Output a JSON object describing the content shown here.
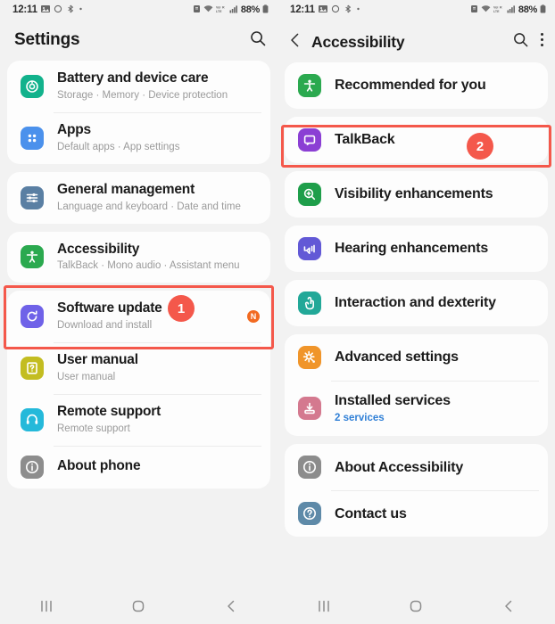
{
  "statusbar": {
    "time": "12:11",
    "battery": "88%",
    "left_icons": [
      "screenshot-icon",
      "circle-icon",
      "bluetooth-share-icon",
      "dot-icon"
    ],
    "right_icons": [
      "alarm-icon",
      "wifi-icon",
      "volte-icon",
      "signal-icon",
      "battery-icon"
    ]
  },
  "left_phone": {
    "appbar": {
      "title": "Settings",
      "search_icon": "search-icon"
    },
    "groups": [
      {
        "rows": [
          {
            "title": "Battery and device care",
            "sub": "Storage · Memory · Device protection",
            "icon": "battery-care-icon",
            "color": "#12b28c"
          },
          {
            "title": "Apps",
            "sub": "Default apps · App settings",
            "icon": "apps-icon",
            "color": "#4b91ec"
          }
        ]
      },
      {
        "rows": [
          {
            "title": "General management",
            "sub": "Language and keyboard · Date and time",
            "icon": "sliders-icon",
            "color": "#5a7fa3"
          }
        ]
      },
      {
        "rows": [
          {
            "title": "Accessibility",
            "sub": "TalkBack · Mono audio · Assistant menu",
            "icon": "accessibility-icon",
            "color": "#2ba94f"
          }
        ]
      },
      {
        "rows": [
          {
            "title": "Software update",
            "sub": "Download and install",
            "icon": "software-update-icon",
            "color": "#6f62e8",
            "badge": "N"
          },
          {
            "title": "User manual",
            "sub": "User manual",
            "icon": "user-manual-icon",
            "color": "#c3bd21"
          },
          {
            "title": "Remote support",
            "sub": "Remote support",
            "icon": "headset-icon",
            "color": "#25b9da"
          },
          {
            "title": "About phone",
            "sub": "",
            "icon": "about-phone-icon",
            "color": "#8d8d8d"
          }
        ]
      }
    ],
    "annotation": {
      "number": "1"
    }
  },
  "right_phone": {
    "appbar": {
      "title": "Accessibility",
      "back_icon": "back-arrow-icon",
      "search_icon": "search-icon",
      "more_icon": "more-vertical-icon"
    },
    "groups": [
      {
        "rows": [
          {
            "title": "Recommended for you",
            "sub": "",
            "icon": "recommended-icon",
            "color": "#2ba94f"
          }
        ]
      },
      {
        "rows": [
          {
            "title": "TalkBack",
            "sub": "",
            "icon": "talkback-icon",
            "color": "#8b3fd4"
          }
        ]
      },
      {
        "rows": [
          {
            "title": "Visibility enhancements",
            "sub": "",
            "icon": "visibility-icon",
            "color": "#1e9e4a"
          }
        ]
      },
      {
        "rows": [
          {
            "title": "Hearing enhancements",
            "sub": "",
            "icon": "hearing-icon",
            "color": "#6259d6"
          }
        ]
      },
      {
        "rows": [
          {
            "title": "Interaction and dexterity",
            "sub": "",
            "icon": "interaction-icon",
            "color": "#22a898"
          }
        ]
      },
      {
        "rows": [
          {
            "title": "Advanced settings",
            "sub": "",
            "icon": "advanced-settings-icon",
            "color": "#f0952a"
          },
          {
            "title": "Installed services",
            "sub": "2 services",
            "icon": "installed-services-icon",
            "color": "#d4798f"
          }
        ]
      },
      {
        "rows": [
          {
            "title": "About Accessibility",
            "sub": "",
            "icon": "info-icon",
            "color": "#8c8c8c"
          },
          {
            "title": "Contact us",
            "sub": "",
            "icon": "contact-us-icon",
            "color": "#5e8aa8"
          }
        ]
      }
    ],
    "annotation": {
      "number": "2"
    }
  },
  "navbar": {
    "recents_icon": "recents-icon",
    "home_icon": "home-icon",
    "back_icon": "back-icon"
  },
  "colors": {
    "annotation_red": "#f4584b",
    "badge_orange": "#f26a21",
    "link_blue": "#2f7fd6"
  }
}
